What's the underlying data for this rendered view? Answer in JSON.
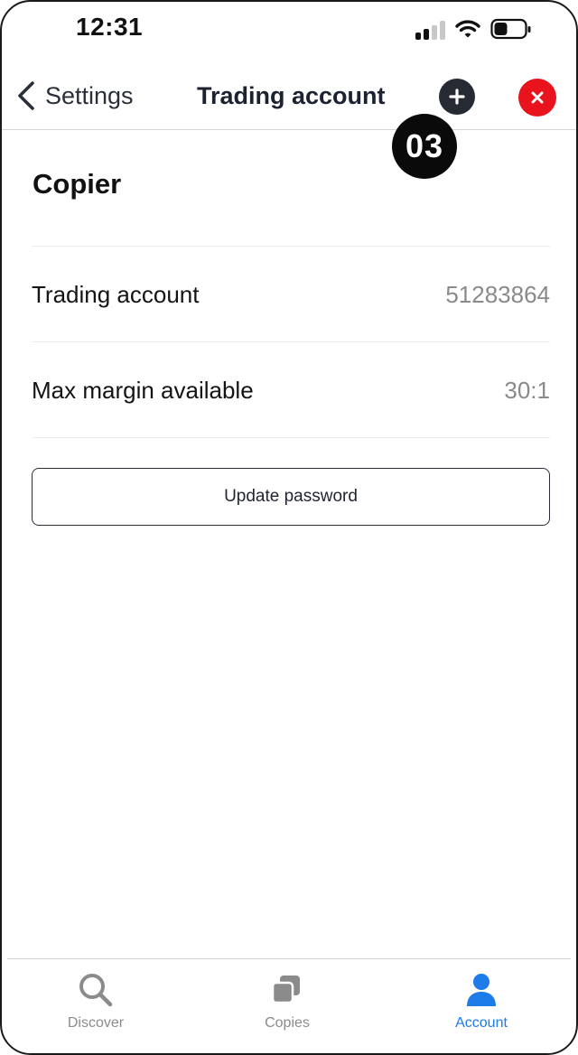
{
  "status_bar": {
    "time": "12:31",
    "icons": [
      "cellular-signal-icon",
      "wifi-icon",
      "battery-icon"
    ]
  },
  "nav": {
    "back_label": "Settings",
    "title": "Trading account",
    "icons": [
      "chevron-left-icon",
      "plus-icon",
      "close-icon"
    ],
    "close_color": "#e8131c",
    "add_color": "#262a33"
  },
  "step_badge": "03",
  "section": {
    "title": "Copier",
    "rows": [
      {
        "label": "Trading account",
        "value": "51283864"
      },
      {
        "label": "Max margin available",
        "value": "30:1"
      }
    ],
    "button_label": "Update password"
  },
  "tabs": [
    {
      "label": "Discover",
      "icon": "search-icon",
      "active": false
    },
    {
      "label": "Copies",
      "icon": "copies-icon",
      "active": false
    },
    {
      "label": "Account",
      "icon": "user-icon",
      "active": true
    }
  ],
  "colors": {
    "accent": "#1d7bea",
    "inactive": "#8b8b8b"
  }
}
